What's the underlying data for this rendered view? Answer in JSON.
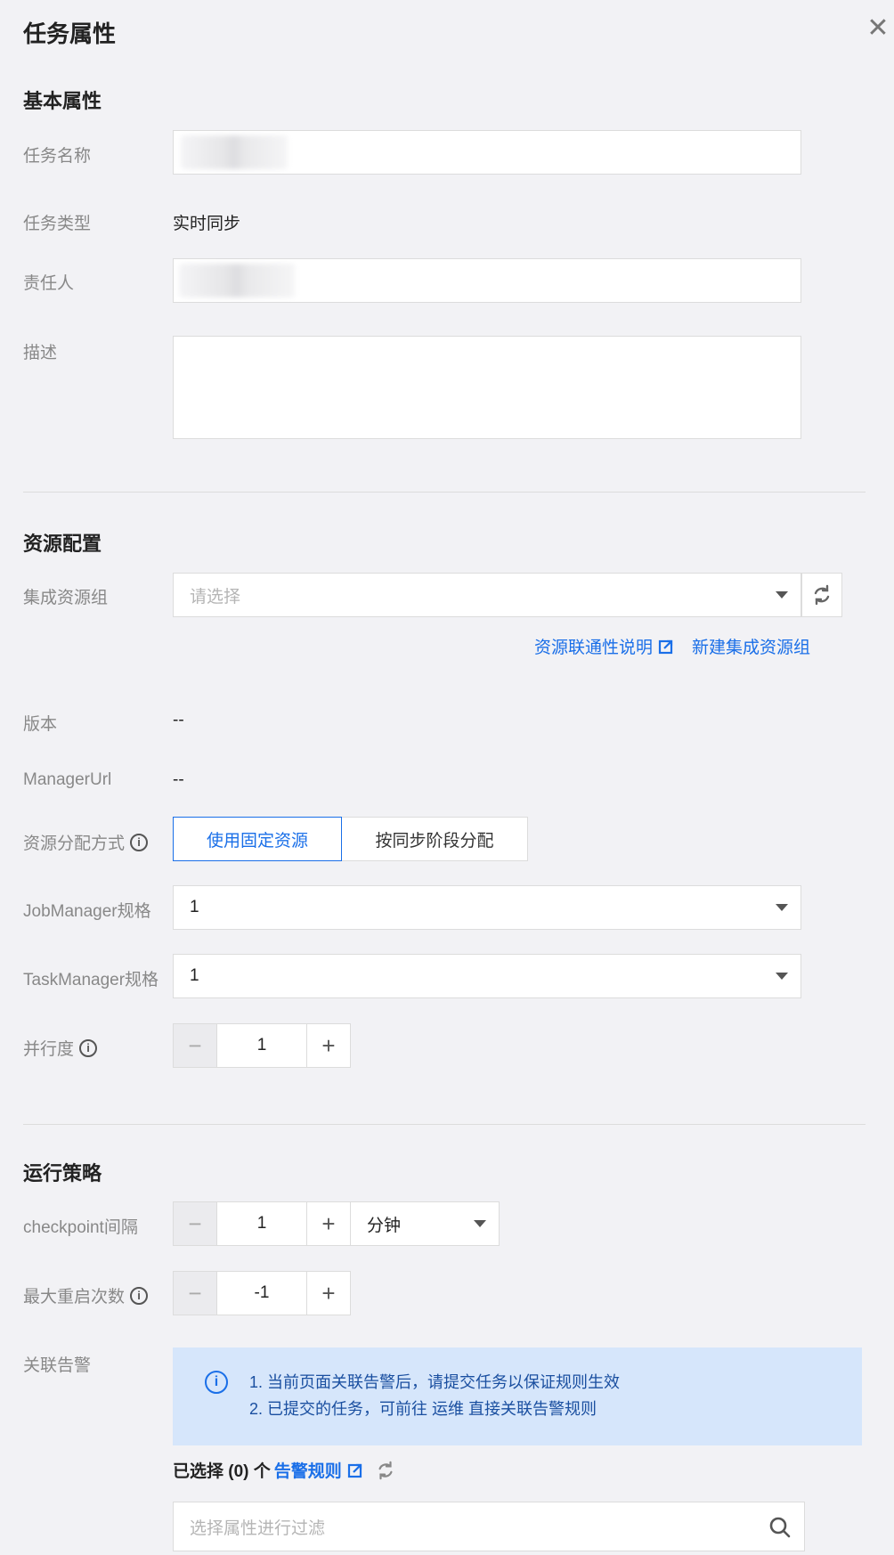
{
  "header": {
    "title": "任务属性",
    "close_icon": "close-icon"
  },
  "basic": {
    "section_title": "基本属性",
    "name_label": "任务名称",
    "type_label": "任务类型",
    "type_value": "实时同步",
    "owner_label": "责任人",
    "desc_label": "描述"
  },
  "resource": {
    "section_title": "资源配置",
    "group_label": "集成资源组",
    "group_placeholder": "请选择",
    "link_connectivity": "资源联通性说明",
    "link_new_group": "新建集成资源组",
    "version_label": "版本",
    "version_value": "--",
    "manager_url_label": "ManagerUrl",
    "manager_url_value": "--",
    "alloc_label": "资源分配方式",
    "alloc_options": [
      "使用固定资源",
      "按同步阶段分配"
    ],
    "alloc_selected": "使用固定资源",
    "job_manager_label": "JobManager规格",
    "job_manager_value": "1",
    "task_manager_label": "TaskManager规格",
    "task_manager_value": "1",
    "parallelism_label": "并行度",
    "parallelism_value": "1"
  },
  "policy": {
    "section_title": "运行策略",
    "checkpoint_label": "checkpoint间隔",
    "checkpoint_value": "1",
    "checkpoint_unit": "分钟",
    "restart_label": "最大重启次数",
    "restart_value": "-1",
    "alarm_label": "关联告警",
    "notice_line1": "1. 当前页面关联告警后，请提交任务以保证规则生效",
    "notice_line2": "2. 已提交的任务，可前往 运维 直接关联告警规则",
    "selected_prefix": "已选择 (0) 个",
    "alarm_rules_link": "告警规则",
    "filter_placeholder": "选择属性进行过滤"
  },
  "colors": {
    "accent": "#1a6fe8",
    "notice_bg": "#d6e6fb",
    "page_bg": "#f2f2f5"
  }
}
